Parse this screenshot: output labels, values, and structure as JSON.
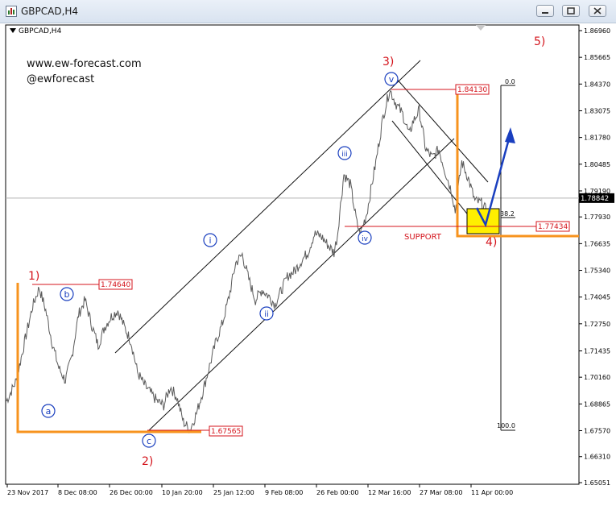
{
  "window": {
    "title": "GBPCAD,H4"
  },
  "chart_data": {
    "type": "line",
    "symbol_label": "GBPCAD,H4",
    "watermark": [
      "www.ew-forecast.com",
      "@ewforecast"
    ],
    "y_ticks": [
      1.6505,
      1.6631,
      1.6757,
      1.68865,
      1.7016,
      1.71435,
      1.7275,
      1.74045,
      1.7534,
      1.76635,
      1.7793,
      1.7919,
      1.80485,
      1.8178,
      1.83075,
      1.8437,
      1.85665,
      1.8696
    ],
    "y_tick_labels": [
      "1.65051",
      "1.66310",
      "1.67570",
      "1.68865",
      "1.70160",
      "1.71435",
      "1.72750",
      "1.74045",
      "1.75340",
      "1.76635",
      "1.77930",
      "1.79190",
      "1.80485",
      "1.81780",
      "1.83075",
      "1.84370",
      "1.85665",
      "1.86960"
    ],
    "x_tick_labels": [
      "23 Nov 2017",
      "8 Dec 08:00",
      "26 Dec 00:00",
      "10 Jan 20:00",
      "25 Jan 12:00",
      "9 Feb 08:00",
      "26 Feb 00:00",
      "12 Mar 16:00",
      "27 Mar 08:00",
      "11 Apr 00:00"
    ],
    "current_price": 1.78842,
    "current_price_label": "1.78842",
    "price_series": [
      [
        0,
        1.69
      ],
      [
        3,
        1.7
      ],
      [
        6,
        1.722
      ],
      [
        8,
        1.736
      ],
      [
        10,
        1.745
      ],
      [
        12,
        1.734
      ],
      [
        14,
        1.718
      ],
      [
        16,
        1.706
      ],
      [
        18,
        1.7
      ],
      [
        20,
        1.712
      ],
      [
        22,
        1.732
      ],
      [
        24,
        1.739
      ],
      [
        26,
        1.727
      ],
      [
        28,
        1.717
      ],
      [
        30,
        1.726
      ],
      [
        32,
        1.731
      ],
      [
        34,
        1.734
      ],
      [
        36,
        1.726
      ],
      [
        38,
        1.719
      ],
      [
        40,
        1.704
      ],
      [
        42,
        1.698
      ],
      [
        44,
        1.694
      ],
      [
        46,
        1.69
      ],
      [
        48,
        1.688
      ],
      [
        50,
        1.697
      ],
      [
        52,
        1.692
      ],
      [
        54,
        1.68
      ],
      [
        56,
        1.676
      ],
      [
        58,
        1.684
      ],
      [
        60,
        1.695
      ],
      [
        62,
        1.707
      ],
      [
        64,
        1.719
      ],
      [
        66,
        1.728
      ],
      [
        68,
        1.741
      ],
      [
        70,
        1.757
      ],
      [
        72,
        1.761
      ],
      [
        74,
        1.749
      ],
      [
        76,
        1.739
      ],
      [
        78,
        1.744
      ],
      [
        80,
        1.741
      ],
      [
        82,
        1.737
      ],
      [
        84,
        1.744
      ],
      [
        86,
        1.751
      ],
      [
        88,
        1.753
      ],
      [
        90,
        1.758
      ],
      [
        92,
        1.762
      ],
      [
        94,
        1.771
      ],
      [
        96,
        1.77
      ],
      [
        98,
        1.766
      ],
      [
        100,
        1.762
      ],
      [
        101,
        1.77
      ],
      [
        103,
        1.8
      ],
      [
        105,
        1.795
      ],
      [
        107,
        1.776
      ],
      [
        108,
        1.771
      ],
      [
        110,
        1.781
      ],
      [
        111,
        1.79
      ],
      [
        113,
        1.808
      ],
      [
        115,
        1.828
      ],
      [
        117,
        1.841
      ],
      [
        119,
        1.834
      ],
      [
        121,
        1.829
      ],
      [
        123,
        1.819
      ],
      [
        124,
        1.825
      ],
      [
        126,
        1.831
      ],
      [
        128,
        1.812
      ],
      [
        130,
        1.808
      ],
      [
        132,
        1.812
      ],
      [
        134,
        1.801
      ],
      [
        136,
        1.791
      ],
      [
        137,
        1.782
      ],
      [
        139,
        1.806
      ],
      [
        141,
        1.798
      ],
      [
        143,
        1.787
      ],
      [
        145,
        1.786
      ],
      [
        147,
        1.781
      ]
    ],
    "fib_labels": [
      "0.0",
      "38.2",
      "100.0"
    ],
    "price_tags": [
      "1.84130",
      "1.77434",
      "1.74640",
      "1.67565"
    ],
    "red_wave_labels": [
      "1)",
      "2)",
      "3)",
      "4)",
      "5)"
    ],
    "circled_labels": [
      "a",
      "b",
      "c",
      "i",
      "ii",
      "iii",
      "iv",
      "v"
    ],
    "annotations": [
      "SUPPORT"
    ],
    "colors": {
      "price": "#5a5a5a",
      "channel": "#111111",
      "orange": "#f7931e",
      "red": "#d4141c",
      "blue": "#1a3fbf",
      "support_box": "#ffef00"
    }
  }
}
